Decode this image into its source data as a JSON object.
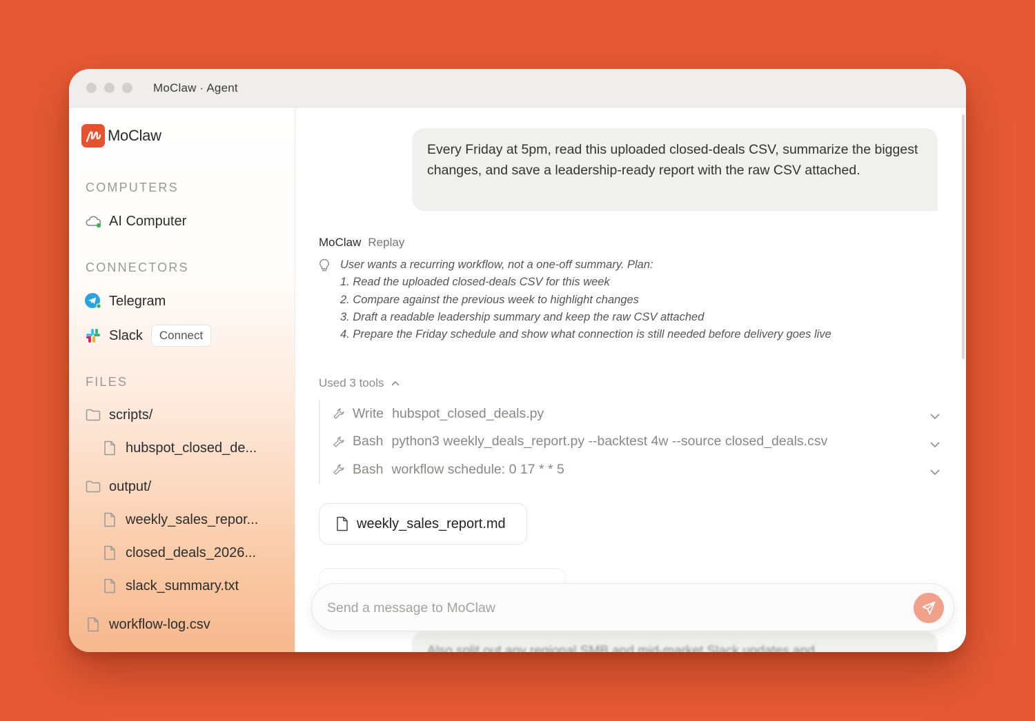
{
  "window": {
    "title": "MoClaw · Agent"
  },
  "brand": {
    "name": "MoClaw",
    "accent": "#e5522f"
  },
  "sidebar": {
    "computers_label": "COMPUTERS",
    "computers": [
      {
        "label": "AI Computer",
        "icon": "cloud-icon",
        "status": "online"
      }
    ],
    "connectors_label": "CONNECTORS",
    "connectors": [
      {
        "label": "Telegram",
        "icon": "telegram-icon",
        "status": "connected"
      },
      {
        "label": "Slack",
        "icon": "slack-icon",
        "action": "Connect"
      }
    ],
    "files_label": "FILES",
    "files": [
      {
        "label": "scripts/",
        "type": "folder"
      },
      {
        "label": "hubspot_closed_de...",
        "type": "file"
      },
      {
        "label": "output/",
        "type": "folder"
      },
      {
        "label": "weekly_sales_repor...",
        "type": "file"
      },
      {
        "label": "closed_deals_2026...",
        "type": "file"
      },
      {
        "label": "slack_summary.txt",
        "type": "file"
      },
      {
        "label": "workflow-log.csv",
        "type": "file"
      }
    ]
  },
  "chat": {
    "user_message": "Every Friday at 5pm, read this uploaded closed-deals CSV, summarize the biggest changes, and save a leadership-ready report with the raw CSV attached.",
    "agent_name": "MoClaw",
    "agent_action": "Replay",
    "thought": {
      "intro": "User wants a recurring workflow, not a one-off summary. Plan:",
      "steps": [
        "1. Read the uploaded closed-deals CSV for this week",
        "2. Compare against the previous week to highlight changes",
        "3. Draft a readable leadership summary and keep the raw CSV attached",
        "4. Prepare the Friday schedule and show what connection is still needed before delivery goes live"
      ]
    },
    "tools_summary": "Used 3 tools",
    "tools": [
      {
        "verb": "Write",
        "detail": "hubspot_closed_deals.py"
      },
      {
        "verb": "Bash",
        "detail": "python3 weekly_deals_report.py --backtest 4w --source closed_deals.csv"
      },
      {
        "verb": "Bash",
        "detail": "workflow schedule: 0 17 * * 5"
      }
    ],
    "attachment": "weekly_sales_report.md",
    "next_message_partial": "Also split out any regional SMB and mid-market Slack updates and"
  },
  "composer": {
    "placeholder": "Send a message to MoClaw",
    "value": ""
  },
  "colors": {
    "background": "#e55a34",
    "send_button": "#f1a08a"
  }
}
